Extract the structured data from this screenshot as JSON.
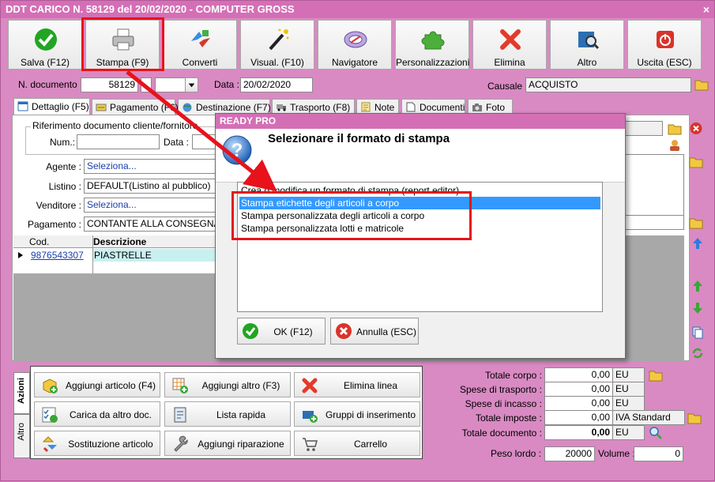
{
  "window": {
    "title": "DDT CARICO N. 58129 del 20/02/2020 - COMPUTER GROSS",
    "close_glyph": "×"
  },
  "toolbar": [
    {
      "label": "Salva (F12)",
      "icon": "check-icon",
      "color": "#1aa31a"
    },
    {
      "label": "Stampa (F9)",
      "icon": "printer-icon",
      "color": "#888888"
    },
    {
      "label": "Converti",
      "icon": "convert-icon",
      "color": "#d33a2a"
    },
    {
      "label": "Visual. (F10)",
      "icon": "magic-wand-icon",
      "color": "#333333"
    },
    {
      "label": "Navigatore",
      "icon": "compass-icon",
      "color": "#6a4fa0"
    },
    {
      "label": "Personalizzazioni",
      "icon": "puzzle-icon",
      "color": "#4caf3a"
    },
    {
      "label": "Elimina",
      "icon": "delete-x-icon",
      "color": "#e23b2a"
    },
    {
      "label": "Altro",
      "icon": "book-search-icon",
      "color": "#2c6fb3"
    },
    {
      "label": "Uscita (ESC)",
      "icon": "power-icon",
      "color": "#d9332a"
    }
  ],
  "header": {
    "doc_label": "N. documento :",
    "doc_number": "58129",
    "data_label": "Data :",
    "data_value": "20/02/2020",
    "causale_label": "Causale :",
    "causale_value": "ACQUISTO"
  },
  "tabs": [
    {
      "label": "Dettaglio (F5)"
    },
    {
      "label": "Pagamento (F6)"
    },
    {
      "label": "Destinazione (F7)"
    },
    {
      "label": "Trasporto (F8)"
    },
    {
      "label": "Note"
    },
    {
      "label": "Documenti"
    },
    {
      "label": "Foto"
    }
  ],
  "detail": {
    "rif_label": "Riferimento documento cliente/fornitore",
    "num_label": "Num.:",
    "data_label": "Data :",
    "agente_label": "Agente :",
    "agente_value": "Seleziona...",
    "listino_label": "Listino :",
    "listino_value": "DEFAULT(Listino al pubblico)",
    "venditore_label": "Venditore :",
    "venditore_value": "Seleziona...",
    "pagamento_label": "Pagamento :",
    "pagamento_value": "CONTANTE ALLA CONSEGNA"
  },
  "grid": {
    "columns": [
      "Cod.",
      "Descrizione"
    ],
    "rows": [
      {
        "cod": "9876543307",
        "descrizione": "PIASTRELLE"
      }
    ]
  },
  "side_tabs": {
    "azioni": "Azioni",
    "altro": "Altro"
  },
  "actions": [
    {
      "label": "Aggiungi articolo (F4)",
      "icon": "add-box-icon"
    },
    {
      "label": "Aggiungi altro (F3)",
      "icon": "add-grid-icon"
    },
    {
      "label": "Elimina linea",
      "icon": "delete-x-icon"
    },
    {
      "label": "Carica da altro doc.",
      "icon": "checklist-icon"
    },
    {
      "label": "Lista rapida",
      "icon": "list-icon"
    },
    {
      "label": "Gruppi di inserimento",
      "icon": "group-add-icon"
    },
    {
      "label": "Sostituzione articolo",
      "icon": "swap-icon"
    },
    {
      "label": "Aggiungi riparazione",
      "icon": "wrench-icon"
    },
    {
      "label": "Carrello",
      "icon": "cart-icon"
    }
  ],
  "totals": {
    "totale_corpo_label": "Totale corpo :",
    "totale_corpo": "0,00",
    "totale_corpo_cur": "EU",
    "spese_trasporto_label": "Spese di trasporto :",
    "spese_trasporto": "0,00",
    "spese_trasporto_cur": "EU",
    "spese_incasso_label": "Spese di incasso :",
    "spese_incasso": "0,00",
    "spese_incasso_cur": "EU",
    "totale_imposte_label": "Totale imposte :",
    "totale_imposte": "0,00",
    "iva": "IVA Standard",
    "totale_documento_label": "Totale documento :",
    "totale_documento": "0,00",
    "totale_documento_cur": "EU",
    "peso_label": "Peso lordo :",
    "peso_value": "20000",
    "volume_label": "Volume :",
    "volume_value": "0"
  },
  "dialog": {
    "title": "READY PRO",
    "heading": "Selezionare il formato di stampa",
    "items": [
      "Crea o modifica un formato di stampa (report editor)",
      "Stampa etichette degli articoli a corpo",
      "Stampa personalizzata degli articoli a corpo",
      "Stampa personalizzata lotti e matricole"
    ],
    "selected_index": 1,
    "ok_label": "OK (F12)",
    "cancel_label": "Annulla (ESC)"
  },
  "colors": {
    "accent": "#d46fb6",
    "background": "#e37fc3",
    "highlight": "#e8121b",
    "selection": "#3399ff"
  }
}
